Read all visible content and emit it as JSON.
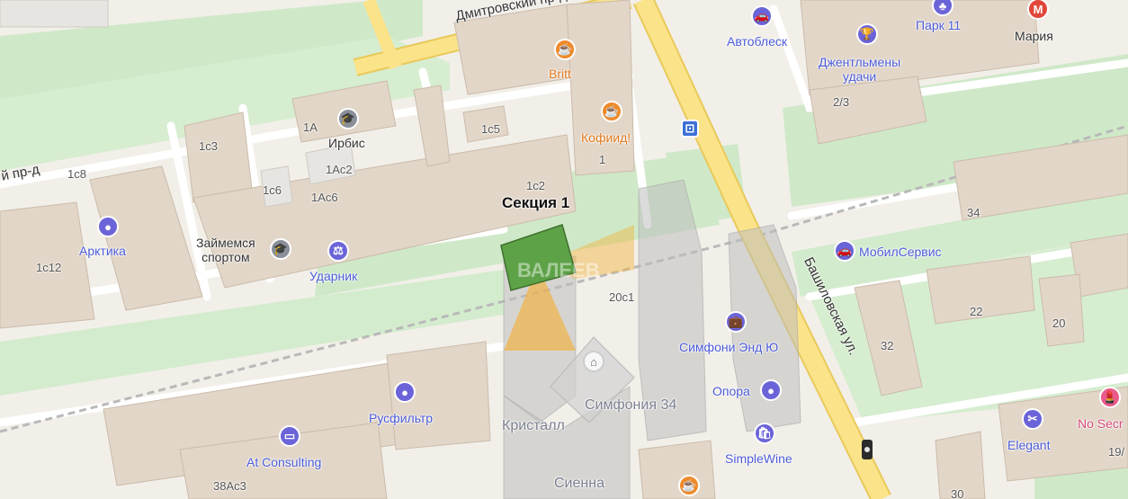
{
  "streets": {
    "dmitrovsky": "Дмитровский пр-д",
    "dmitrovsky_left": "й пр-д",
    "bashilovskaya": "Башиловская ул."
  },
  "target": {
    "title": "Секция 1",
    "watermark": "ВАЛЕЕВ"
  },
  "poi": {
    "britt": "Britt",
    "kofiid": "Кофиид!",
    "avtoblesk": "Автоблеск",
    "park11": "Парк 11",
    "mariya": "Мария",
    "gentlemen": "Джентльмены\nудачи",
    "irbis": "Ирбис",
    "arktika": "Арктика",
    "zaimemsya": "Займемся\nспортом",
    "udarnik": "Ударник",
    "mobilservis": "МобилСервис",
    "simfoni": "Симфони Энд Ю",
    "opora": "Опора",
    "rusfiltr": "Русфильтр",
    "atconsulting": "At Consulting",
    "simplewine": "SimpleWine",
    "elegant": "Elegant",
    "nosecret": "No Secr",
    "kristall": "Кристалл",
    "simfoniya34": "Симфония 34",
    "sienna": "Сиенна"
  },
  "addresses": {
    "a1A": "1А",
    "a1c5": "1с5",
    "a1c3": "1с3",
    "a1Ac2": "1Ас2",
    "a1c6": "1с6",
    "a1Ac6": "1Ас6",
    "a1c2": "1с2",
    "a1": "1",
    "a1c8": "1с8",
    "a1c12": "1с12",
    "a2_3": "2/3",
    "a34": "34",
    "a20c1": "20с1",
    "a32": "32",
    "a22": "22",
    "a20": "20",
    "a38Ac3": "38Ас3",
    "a30": "30",
    "a19": "19/"
  },
  "colors": {
    "target_fill": "#5ea247",
    "fov": "#f2b13a",
    "main_road": "#fbe38a",
    "greenery": "#cdeccb"
  }
}
